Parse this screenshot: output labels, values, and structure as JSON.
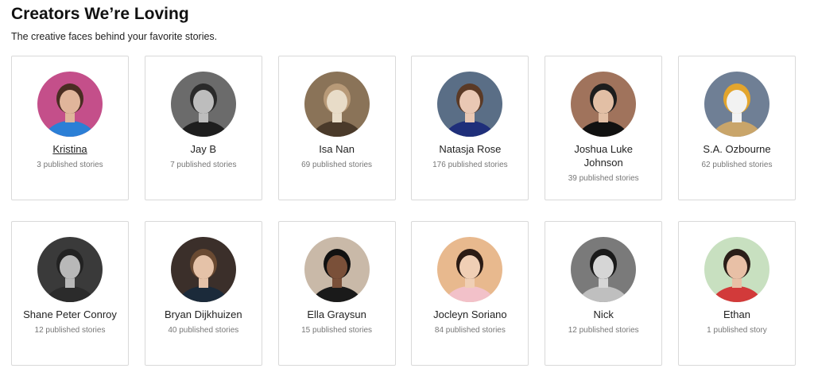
{
  "header": {
    "title": "Creators We’re Loving",
    "subtitle": "The creative faces behind your favorite stories."
  },
  "creators": [
    {
      "name": "Kristina",
      "stories": "3 published stories",
      "linked": true,
      "icon": "avatar-kristina-icon",
      "palette": {
        "bg": "#c44f8a",
        "skin": "#e0b59b",
        "hair": "#4a2d22",
        "shirt": "#2b7fd6"
      }
    },
    {
      "name": "Jay B",
      "stories": "7 published stories",
      "linked": false,
      "icon": "avatar-jay-b-icon",
      "palette": {
        "bg": "#6b6b6b",
        "skin": "#bdbdbd",
        "hair": "#2a2a2a",
        "shirt": "#1e1e1e"
      }
    },
    {
      "name": "Isa Nan",
      "stories": "69 published stories",
      "linked": false,
      "icon": "avatar-isa-nan-icon",
      "palette": {
        "bg": "#8a7358",
        "skin": "#e8dcc8",
        "hair": "#b89a78",
        "shirt": "#4a3a2a"
      }
    },
    {
      "name": "Natasja Rose",
      "stories": "176 published stories",
      "linked": false,
      "icon": "avatar-natasja-rose-icon",
      "palette": {
        "bg": "#5a6e86",
        "skin": "#e9c8b4",
        "hair": "#5b3a26",
        "shirt": "#1f2f7a"
      }
    },
    {
      "name": "Joshua Luke Johnson",
      "stories": "39 published stories",
      "linked": false,
      "icon": "avatar-joshua-luke-johnson-icon",
      "palette": {
        "bg": "#a0735c",
        "skin": "#e2bfa5",
        "hair": "#1d1d1d",
        "shirt": "#111111"
      }
    },
    {
      "name": "S.A. Ozbourne",
      "stories": "62 published stories",
      "linked": false,
      "icon": "avatar-sa-ozbourne-icon",
      "palette": {
        "bg": "#6f7f95",
        "skin": "#f2f2f2",
        "hair": "#e3a52d",
        "shirt": "#c9a56a"
      }
    },
    {
      "name": "Shane Peter Conroy",
      "stories": "12 published stories",
      "linked": false,
      "icon": "avatar-shane-peter-conroy-icon",
      "palette": {
        "bg": "#3a3a3a",
        "skin": "#b8b8b8",
        "hair": "#222222",
        "shirt": "#2b2b2b"
      }
    },
    {
      "name": "Bryan Dijkhuizen",
      "stories": "40 published stories",
      "linked": false,
      "icon": "avatar-bryan-dijkhuizen-icon",
      "palette": {
        "bg": "#3b2f2a",
        "skin": "#e5c2a8",
        "hair": "#6a4a32",
        "shirt": "#1b2a3a"
      }
    },
    {
      "name": "Ella Graysun",
      "stories": "15 published stories",
      "linked": false,
      "icon": "avatar-ella-graysun-icon",
      "palette": {
        "bg": "#c9b9a8",
        "skin": "#7a5039",
        "hair": "#111111",
        "shirt": "#1a1a1a"
      }
    },
    {
      "name": "Jocleyn Soriano",
      "stories": "84 published stories",
      "linked": false,
      "icon": "avatar-jocleyn-soriano-icon",
      "palette": {
        "bg": "#e8b98e",
        "skin": "#f0cfb5",
        "hair": "#2b1b14",
        "shirt": "#f2c1c9"
      }
    },
    {
      "name": "Nick",
      "stories": "12 published stories",
      "linked": false,
      "icon": "avatar-nick-icon",
      "palette": {
        "bg": "#7a7a7a",
        "skin": "#d6d6d6",
        "hair": "#1a1a1a",
        "shirt": "#bfbfbf"
      }
    },
    {
      "name": "Ethan",
      "stories": "1 published story",
      "linked": false,
      "icon": "avatar-ethan-icon",
      "palette": {
        "bg": "#c8e0c0",
        "skin": "#e8c0a6",
        "hair": "#2a1e18",
        "shirt": "#d23a3a"
      }
    }
  ]
}
